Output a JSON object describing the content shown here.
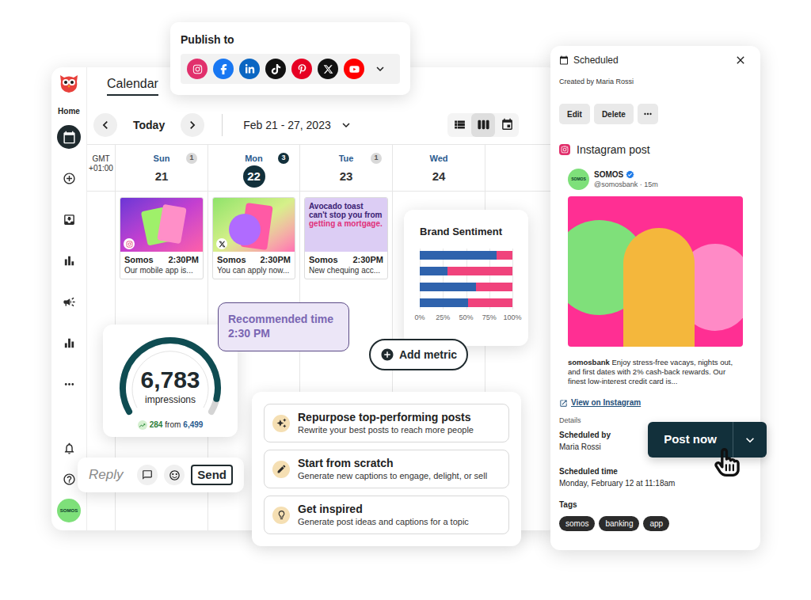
{
  "sidebar": {
    "home_label": "Home",
    "items": [
      {
        "kind": "calendar",
        "selected": true
      },
      {
        "kind": "create",
        "selected": false
      },
      {
        "kind": "inbox",
        "selected": false
      },
      {
        "kind": "analytics",
        "selected": false
      },
      {
        "kind": "ads",
        "selected": false
      },
      {
        "kind": "insights",
        "selected": false
      },
      {
        "kind": "more",
        "selected": false
      }
    ],
    "bottom_items": [
      {
        "kind": "notifications"
      },
      {
        "kind": "help"
      }
    ],
    "avatar": "SOMOS"
  },
  "publish": {
    "title": "Publish to",
    "networks": [
      {
        "kind": "instagram",
        "color": "#e1306c"
      },
      {
        "kind": "facebook",
        "color": "#1877f2"
      },
      {
        "kind": "linkedin",
        "color": "#0a66c2"
      },
      {
        "kind": "tiktok",
        "color": "#111111"
      },
      {
        "kind": "pinterest",
        "color": "#e60023"
      },
      {
        "kind": "x",
        "color": "#111111"
      },
      {
        "kind": "youtube",
        "color": "#ff0000"
      }
    ]
  },
  "calendar": {
    "title": "Calendar",
    "today": "Today",
    "range": "Feb 21 - 27, 2023",
    "views": [
      {
        "kind": "list",
        "selected": false
      },
      {
        "kind": "week",
        "selected": true
      },
      {
        "kind": "month",
        "selected": false
      }
    ],
    "timezone": [
      "GMT",
      "+01:00"
    ],
    "days": [
      {
        "name": "Sun",
        "date": "21",
        "count": "1",
        "selected": false,
        "posts": [
          {
            "kind": "purple-photo",
            "network": "instagram",
            "author": "Somos",
            "time": "2:30PM",
            "text": "Our mobile app is..."
          }
        ]
      },
      {
        "name": "Mon",
        "date": "22",
        "count": "3",
        "selected": true,
        "posts": [
          {
            "kind": "green-photo",
            "network": "x",
            "author": "Somos",
            "time": "2:30PM",
            "text": "You can apply now..."
          }
        ]
      },
      {
        "name": "Tue",
        "date": "23",
        "count": "1",
        "selected": false,
        "posts": [
          {
            "kind": "graphic",
            "author": "Somos",
            "time": "2:30PM",
            "text": "New chequing acc...",
            "graphic_text": "Avocado toast can't stop you from ",
            "graphic_highlight": "getting a mortgage."
          }
        ]
      },
      {
        "name": "Wed",
        "date": "24",
        "selected": false,
        "posts": []
      }
    ]
  },
  "brand_sentiment": {
    "title": "Brand Sentiment",
    "series": [
      {
        "color": "#2f63ad",
        "values": [
          83,
          30,
          61,
          52
        ]
      },
      {
        "color": "#f0437c",
        "values": [
          17,
          70,
          39,
          48
        ]
      }
    ],
    "ticks": [
      "0%",
      "25%",
      "50%",
      "75%",
      "100%"
    ]
  },
  "recommended": {
    "label": "Recommended time",
    "time": "2:30 PM"
  },
  "add_metric": {
    "label": "Add metric"
  },
  "impressions": {
    "value": "6,783",
    "label": "impressions",
    "level": 0.93,
    "change": "284",
    "from_word": "from",
    "previous": "6,499"
  },
  "reply": {
    "placeholder": "Reply",
    "send": "Send"
  },
  "ai_actions": [
    {
      "kind": "repurpose",
      "title": "Repurpose top-performing posts",
      "description": "Rewrite your best posts to reach more people"
    },
    {
      "kind": "scratch",
      "title": "Start from scratch",
      "description": "Generate new captions to engage, delight, or sell"
    },
    {
      "kind": "inspire",
      "title": "Get inspired",
      "description": "Generate post ideas and captions for a topic"
    }
  ],
  "panel": {
    "title": "Scheduled",
    "created_by": "Created by Maria Rossi",
    "actions": [
      {
        "kind": "text",
        "label": "Edit"
      },
      {
        "kind": "text",
        "label": "Delete"
      },
      {
        "kind": "more"
      }
    ],
    "post_type": "Instagram post",
    "account": {
      "avatar": "SOMOS",
      "name": "SOMOS",
      "meta": "@somosbank · 15m",
      "verified": true
    },
    "caption_user": "somosbank",
    "caption": "Enjoy stress-free vacays, nights out, and first dates with 2% cash-back rewards. Our finest low-interest credit card is...",
    "link": "View on Instagram",
    "details_label": "Details",
    "fields": [
      {
        "label": "Scheduled by",
        "value": "Maria Rossi"
      },
      {
        "label": "Scheduled time",
        "value": "Monday, February 12 at 11:18am"
      }
    ],
    "tags_label": "Tags",
    "tags": [
      "somos",
      "banking",
      "app"
    ]
  },
  "post_now": {
    "label": "Post now"
  }
}
